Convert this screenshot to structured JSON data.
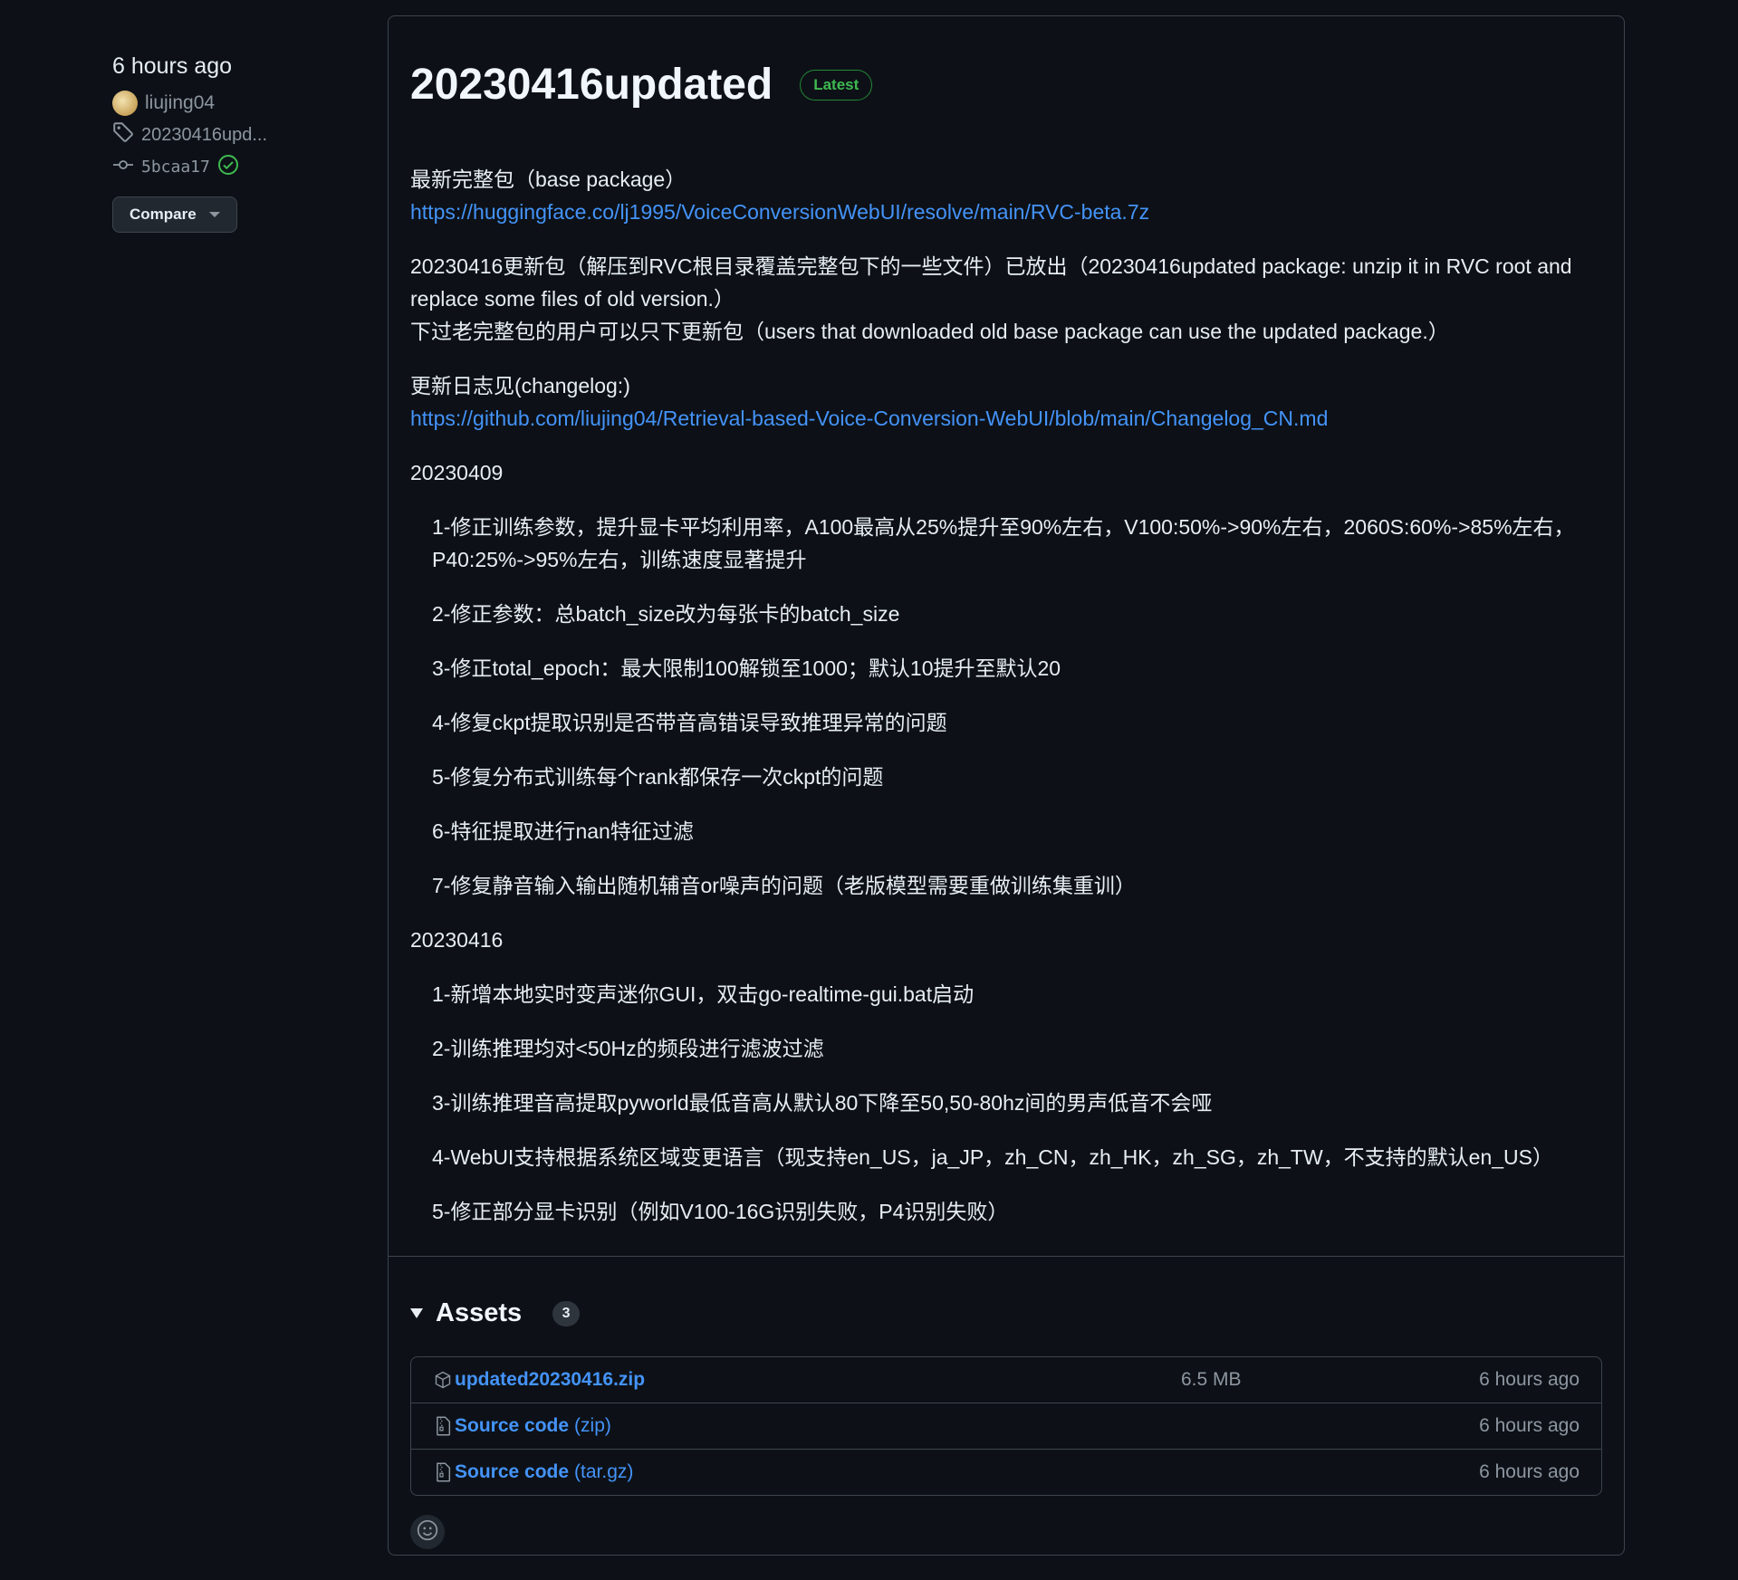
{
  "sidebar": {
    "time": "6 hours ago",
    "author": "liujing04",
    "tag": "20230416upd...",
    "commit": "5bcaa17",
    "compare_label": "Compare"
  },
  "release": {
    "title": "20230416updated",
    "badge": "Latest",
    "body": {
      "p1_text": "最新完整包（base package）",
      "p1_link": "https://huggingface.co/lj1995/VoiceConversionWebUI/resolve/main/RVC-beta.7z",
      "p2_line1": "20230416更新包（解压到RVC根目录覆盖完整包下的一些文件）已放出（20230416updated package: unzip it in RVC root and replace some files of old version.）",
      "p2_line2": "下过老完整包的用户可以只下更新包（users that downloaded old base package can use the updated package.）",
      "p3_text": "更新日志见(changelog:)",
      "p3_link": "https://github.com/liujing04/Retrieval-based-Voice-Conversion-WebUI/blob/main/Changelog_CN.md",
      "section1_title": "20230409",
      "section1_items": [
        "1-修正训练参数，提升显卡平均利用率，A100最高从25%提升至90%左右，V100:50%->90%左右，2060S:60%->85%左右，P40:25%->95%左右，训练速度显著提升",
        "2-修正参数：总batch_size改为每张卡的batch_size",
        "3-修正total_epoch：最大限制100解锁至1000；默认10提升至默认20",
        "4-修复ckpt提取识别是否带音高错误导致推理异常的问题",
        "5-修复分布式训练每个rank都保存一次ckpt的问题",
        "6-特征提取进行nan特征过滤",
        "7-修复静音输入输出随机辅音or噪声的问题（老版模型需要重做训练集重训）"
      ],
      "section2_title": "20230416",
      "section2_items": [
        "1-新增本地实时变声迷你GUI，双击go-realtime-gui.bat启动",
        "2-训练推理均对<50Hz的频段进行滤波过滤",
        "3-训练推理音高提取pyworld最低音高从默认80下降至50,50-80hz间的男声低音不会哑",
        "4-WebUI支持根据系统区域变更语言（现支持en_US，ja_JP，zh_CN，zh_HK，zh_SG，zh_TW，不支持的默认en_US）",
        "5-修正部分显卡识别（例如V100-16G识别失败，P4识别失败）"
      ]
    }
  },
  "assets": {
    "label": "Assets",
    "count": "3",
    "items": [
      {
        "name": "updated20230416.zip",
        "sub": "",
        "size": "6.5 MB",
        "when": "6 hours ago",
        "icon": "package-icon"
      },
      {
        "name": "Source code",
        "sub": "(zip)",
        "size": "",
        "when": "6 hours ago",
        "icon": "file-zip-icon"
      },
      {
        "name": "Source code",
        "sub": "(tar.gz)",
        "size": "",
        "when": "6 hours ago",
        "icon": "file-zip-icon"
      }
    ]
  },
  "colors": {
    "background": "#0d1117",
    "link": "#4493f8",
    "latest_badge": "#3fb950",
    "border": "#3d444d"
  }
}
